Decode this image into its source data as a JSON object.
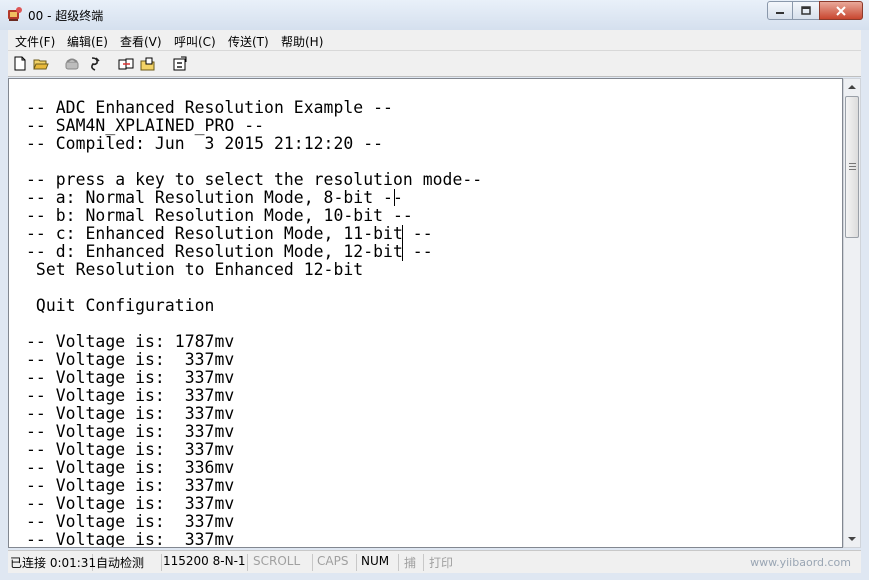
{
  "window": {
    "title": "00 - 超级终端"
  },
  "menu": [
    {
      "label": "文件(F)"
    },
    {
      "label": "编辑(E)"
    },
    {
      "label": "查看(V)"
    },
    {
      "label": "呼叫(C)"
    },
    {
      "label": "传送(T)"
    },
    {
      "label": "帮助(H)"
    }
  ],
  "toolbar": {
    "icons": [
      "new-file-icon",
      "open-folder-icon",
      "call-icon",
      "disconnect-icon",
      "send-file-icon",
      "receive-file-icon",
      "properties-icon"
    ]
  },
  "terminal": {
    "lines": [
      "-- ADC Enhanced Resolution Example --",
      "-- SAM4N_XPLAINED_PRO --",
      "-- Compiled: Jun  3 2015 21:12:20 --",
      "",
      "-- press a key to select the resolution mode--",
      "-- a: Normal Resolution Mode, 8-bit --",
      "-- b: Normal Resolution Mode, 10-bit --",
      "-- c: Enhanced Resolution Mode, 11-bit --",
      "-- d: Enhanced Resolution Mode, 12-bit --",
      " Set Resolution to Enhanced 12-bit",
      "",
      " Quit Configuration",
      "",
      "-- Voltage is: 1787mv",
      "-- Voltage is:  337mv",
      "-- Voltage is:  337mv",
      "-- Voltage is:  337mv",
      "-- Voltage is:  337mv",
      "-- Voltage is:  337mv",
      "-- Voltage is:  337mv",
      "-- Voltage is:  336mv",
      "-- Voltage is:  337mv",
      "-- Voltage is:  337mv",
      "-- Voltage is:  337mv",
      "-- Voltage is:  337mv"
    ]
  },
  "status": {
    "connection": "已连接 0:01:31",
    "detect": "自动检测",
    "port": "115200 8-N-1",
    "scroll": "SCROLL",
    "caps": "CAPS",
    "num": "NUM",
    "capture": "捕",
    "print": "打印"
  },
  "watermark": "www.yiibaord.com",
  "colors": {
    "titlebar": "#dfe7f2",
    "close": "#c8462f",
    "background": "#ffffff"
  }
}
